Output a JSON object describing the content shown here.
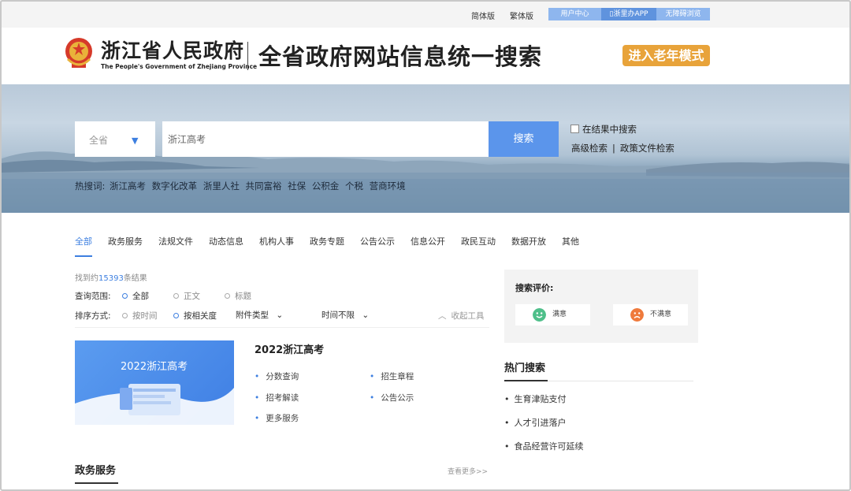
{
  "topbar": {
    "simplified": "简体版",
    "traditional": "繁体版",
    "user_center": "用户中心",
    "app": "浙里办APP",
    "accessibility": "无障碍浏览"
  },
  "header": {
    "site_title": "浙江省人民政府",
    "site_subtitle": "The People's Government of Zhejiang Province",
    "page_heading": "全省政府网站信息统一搜索",
    "elder_mode": "进入老年模式"
  },
  "search": {
    "region": "全省",
    "query": "浙江高考",
    "button": "搜索",
    "in_results": "在结果中搜索",
    "advanced": "高级检索",
    "separator": "|",
    "policy_search": "政策文件检索"
  },
  "hot_words": {
    "label": "热搜词:",
    "items": [
      "浙江高考",
      "数字化改革",
      "浙里人社",
      "共同富裕",
      "社保",
      "公积金",
      "个税",
      "营商环境"
    ]
  },
  "tabs": [
    "全部",
    "政务服务",
    "法规文件",
    "动态信息",
    "机构人事",
    "政务专题",
    "公告公示",
    "信息公开",
    "政民互动",
    "数据开放",
    "其他"
  ],
  "results": {
    "prefix": "找到约",
    "count": "15393",
    "suffix": "条结果"
  },
  "filters": {
    "scope_label": "查询范围:",
    "scope_options": [
      "全部",
      "正文",
      "标题"
    ],
    "sort_label": "排序方式:",
    "sort_options": [
      "按时间",
      "按相关度"
    ],
    "attachment": "附件类型",
    "time": "时间不限",
    "collapse": "收起工具"
  },
  "promo": {
    "image_caption": "2022浙江高考",
    "title": "2022浙江高考",
    "links": [
      "分数查询",
      "招生章程",
      "招考解读",
      "公告公示",
      "更多服务"
    ]
  },
  "section": {
    "title": "政务服务",
    "more": "查看更多>>"
  },
  "rating": {
    "label": "搜索评价:",
    "satisfied": "满意",
    "unsatisfied": "不满意"
  },
  "hot_search": {
    "title": "热门搜索",
    "items": [
      "生育津贴支付",
      "人才引进落户",
      "食品经营许可延续"
    ]
  },
  "colors": {
    "accent": "#3d7fe0",
    "search_button": "#5b95eb",
    "elder_button": "#e8a33a"
  }
}
